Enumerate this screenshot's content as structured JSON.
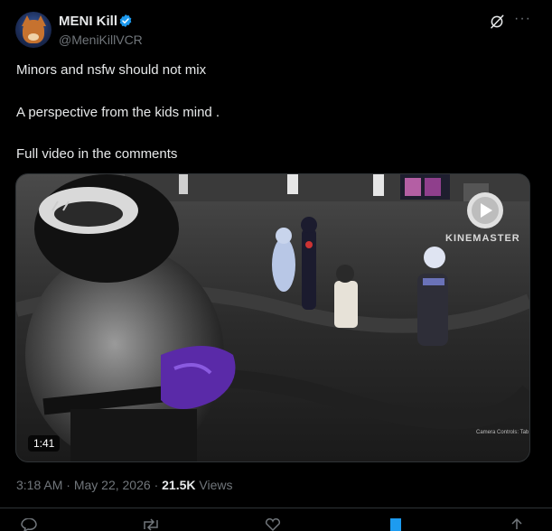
{
  "post": {
    "author": {
      "display_name": "MENI Kill",
      "handle": "@MeniKillVCR",
      "avatar_icon": "fox-avatar"
    },
    "lines": [
      "Minors and nsfw should not mix",
      "A perspective from the kids mind .",
      "Full video in the comments"
    ],
    "media": {
      "duration": "1:41",
      "watermark": "KINEMASTER",
      "camera_note": "Camera Controls: Tab"
    },
    "meta": {
      "time": "3:18 AM",
      "separator": "·",
      "date": "May 22, 2026",
      "views_count": "21.5K",
      "views_label": "Views"
    }
  },
  "colors": {
    "background": "#000000",
    "text": "#e7e9ea",
    "secondary": "#71767b",
    "verified": "#1d9bf0",
    "border": "#2f3336"
  },
  "icons": [
    "verified-badge-icon",
    "grok-icon",
    "more-icon",
    "reply-icon",
    "repost-icon",
    "like-icon",
    "bookmark-icon",
    "share-icon"
  ]
}
